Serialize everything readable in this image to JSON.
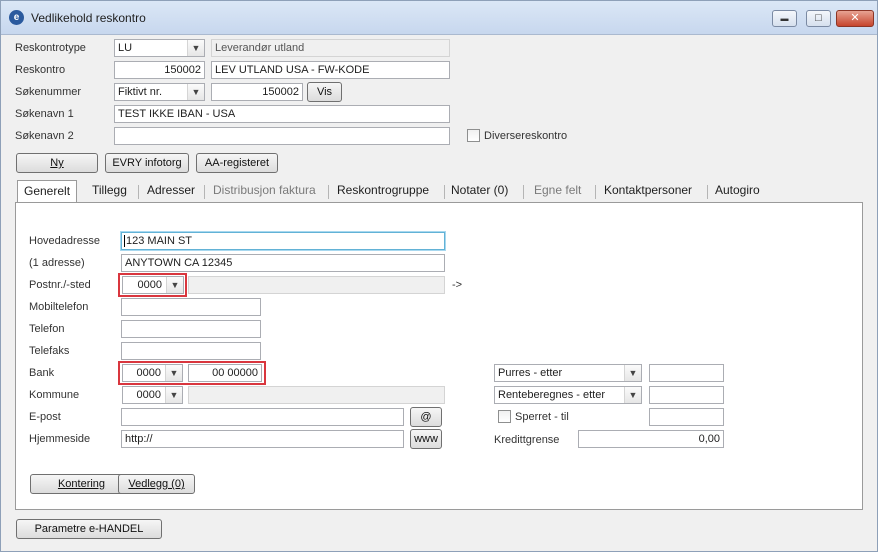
{
  "window": {
    "title": "Vedlikehold reskontro",
    "icon": "e",
    "buttons": {
      "minimize": "▬",
      "maximize": "□",
      "close": "✕"
    }
  },
  "header": {
    "reskontrotype": {
      "label": "Reskontrotype",
      "value": "LU",
      "description": "Leverandør utland"
    },
    "reskontro": {
      "label": "Reskontro",
      "number": "150002",
      "name": "LEV UTLAND USA  - FW-KODE"
    },
    "sokenummer": {
      "label": "Søkenummer",
      "type": "Fiktivt nr.",
      "value": "150002",
      "vis_label": "Vis"
    },
    "sokenavn1": {
      "label": "Søkenavn 1",
      "value": "TEST IKKE IBAN - USA"
    },
    "sokenavn2": {
      "label": "Søkenavn 2",
      "value": ""
    },
    "diversereskontro": {
      "label": "Diversereskontro",
      "checked": false
    }
  },
  "actions": {
    "ny": "Ny",
    "evry": "EVRY infotorg",
    "aa": "AA-registeret"
  },
  "tabs": [
    {
      "label": "Generelt",
      "active": true,
      "disabled": false
    },
    {
      "label": "Tillegg",
      "active": false,
      "disabled": false
    },
    {
      "label": "Adresser",
      "active": false,
      "disabled": false
    },
    {
      "label": "Distribusjon faktura",
      "active": false,
      "disabled": true
    },
    {
      "label": "Reskontrogruppe",
      "active": false,
      "disabled": false
    },
    {
      "label": "Notater (0)",
      "active": false,
      "disabled": false
    },
    {
      "label": "Egne felt",
      "active": false,
      "disabled": true
    },
    {
      "label": "Kontaktpersoner",
      "active": false,
      "disabled": false
    },
    {
      "label": "Autogiro",
      "active": false,
      "disabled": false
    }
  ],
  "generelt": {
    "hovedadresse": {
      "label": "Hovedadresse",
      "value": "123 MAIN ST"
    },
    "adresse1": {
      "label": "(1 adresse)",
      "value": "ANYTOWN CA 12345"
    },
    "postnr": {
      "label": "Postnr./-sted",
      "value": "0000",
      "sted": "",
      "arrow": "->"
    },
    "mobiltelefon": {
      "label": "Mobiltelefon",
      "value": ""
    },
    "telefon": {
      "label": "Telefon",
      "value": ""
    },
    "telefaks": {
      "label": "Telefaks",
      "value": ""
    },
    "bank": {
      "label": "Bank",
      "code": "0000",
      "account": "00 00000"
    },
    "kommune": {
      "label": "Kommune",
      "value": "0000",
      "name": ""
    },
    "epost": {
      "label": "E-post",
      "value": "",
      "button": "@"
    },
    "hjemmeside": {
      "label": "Hjemmeside",
      "value": "http://",
      "button": "www"
    },
    "purres": {
      "value": "Purres - etter",
      "input": ""
    },
    "renteberegnes": {
      "value": "Renteberegnes - etter",
      "input": ""
    },
    "sperret": {
      "label": "Sperret  - til",
      "checked": false,
      "input": ""
    },
    "kredittgrense": {
      "label": "Kredittgrense",
      "value": "0,00"
    },
    "kontering": "Kontering",
    "vedlegg": "Vedlegg (0)"
  },
  "footer": {
    "parametre": "Parametre e-HANDEL"
  },
  "colors": {
    "highlight": "#d9363e",
    "focus": "#62b2d6",
    "titlebar": "#c7d7ee"
  }
}
